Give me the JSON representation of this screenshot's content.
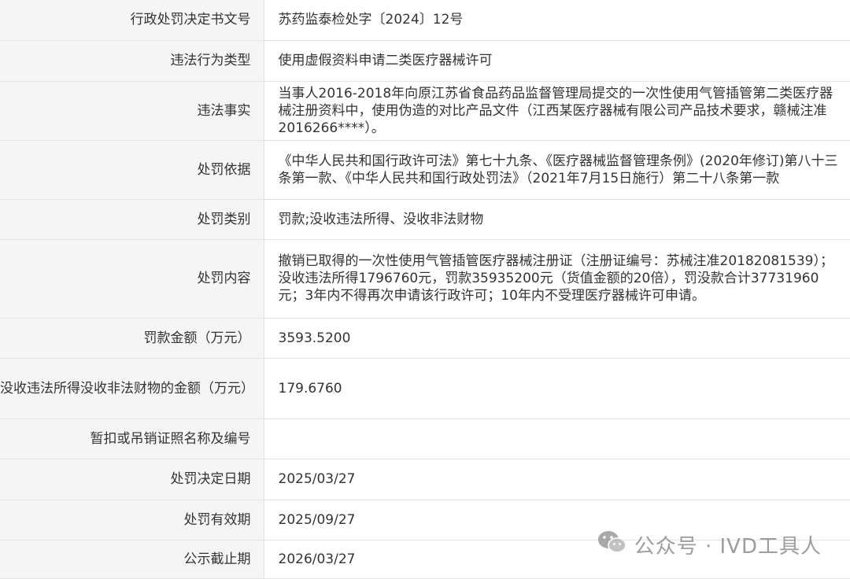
{
  "rows": [
    {
      "label": "行政处罚决定书文号",
      "value": "苏药监泰检处字〔2024〕12号"
    },
    {
      "label": "违法行为类型",
      "value": "使用虚假资料申请二类医疗器械许可"
    },
    {
      "label": "违法事实",
      "value": "当事人2016-2018年向原江苏省食品药品监督管理局提交的一次性使用气管插管第二类医疗器械注册资料中，使用伪造的对比产品文件（江西某医疗器械有限公司产品技术要求，赣械注准2016266****）。"
    },
    {
      "label": "处罚依据",
      "value": "《中华人民共和国行政许可法》第七十九条、《医疗器械监督管理条例》(2020年修订)第八十三条第一款、《中华人民共和国行政处罚法》（2021年7月15日施行）第二十八条第一款"
    },
    {
      "label": "处罚类别",
      "value": "罚款;没收违法所得、没收非法财物"
    },
    {
      "label": "处罚内容",
      "value": "撤销已取得的一次性使用气管插管医疗器械注册证（注册证编号：苏械注准20182081539）；没收违法所得1796760元，罚款35935200元（货值金额的20倍），罚没款合计37731960元；3年内不得再次申请该行政许可；10年内不受理医疗器械许可申请。"
    },
    {
      "label": "罚款金额（万元）",
      "value": "3593.5200"
    },
    {
      "label": "没收违法所得没收非法财物的金额（万元）",
      "value": "179.6760"
    },
    {
      "label": "暂扣或吊销证照名称及编号",
      "value": ""
    },
    {
      "label": "处罚决定日期",
      "value": "2025/03/27"
    },
    {
      "label": "处罚有效期",
      "value": "2025/09/27"
    },
    {
      "label": "公示截止期",
      "value": "2026/03/27"
    }
  ],
  "watermark": {
    "text": "公众号 · IVD工具人",
    "icon": "wechat-icon"
  }
}
